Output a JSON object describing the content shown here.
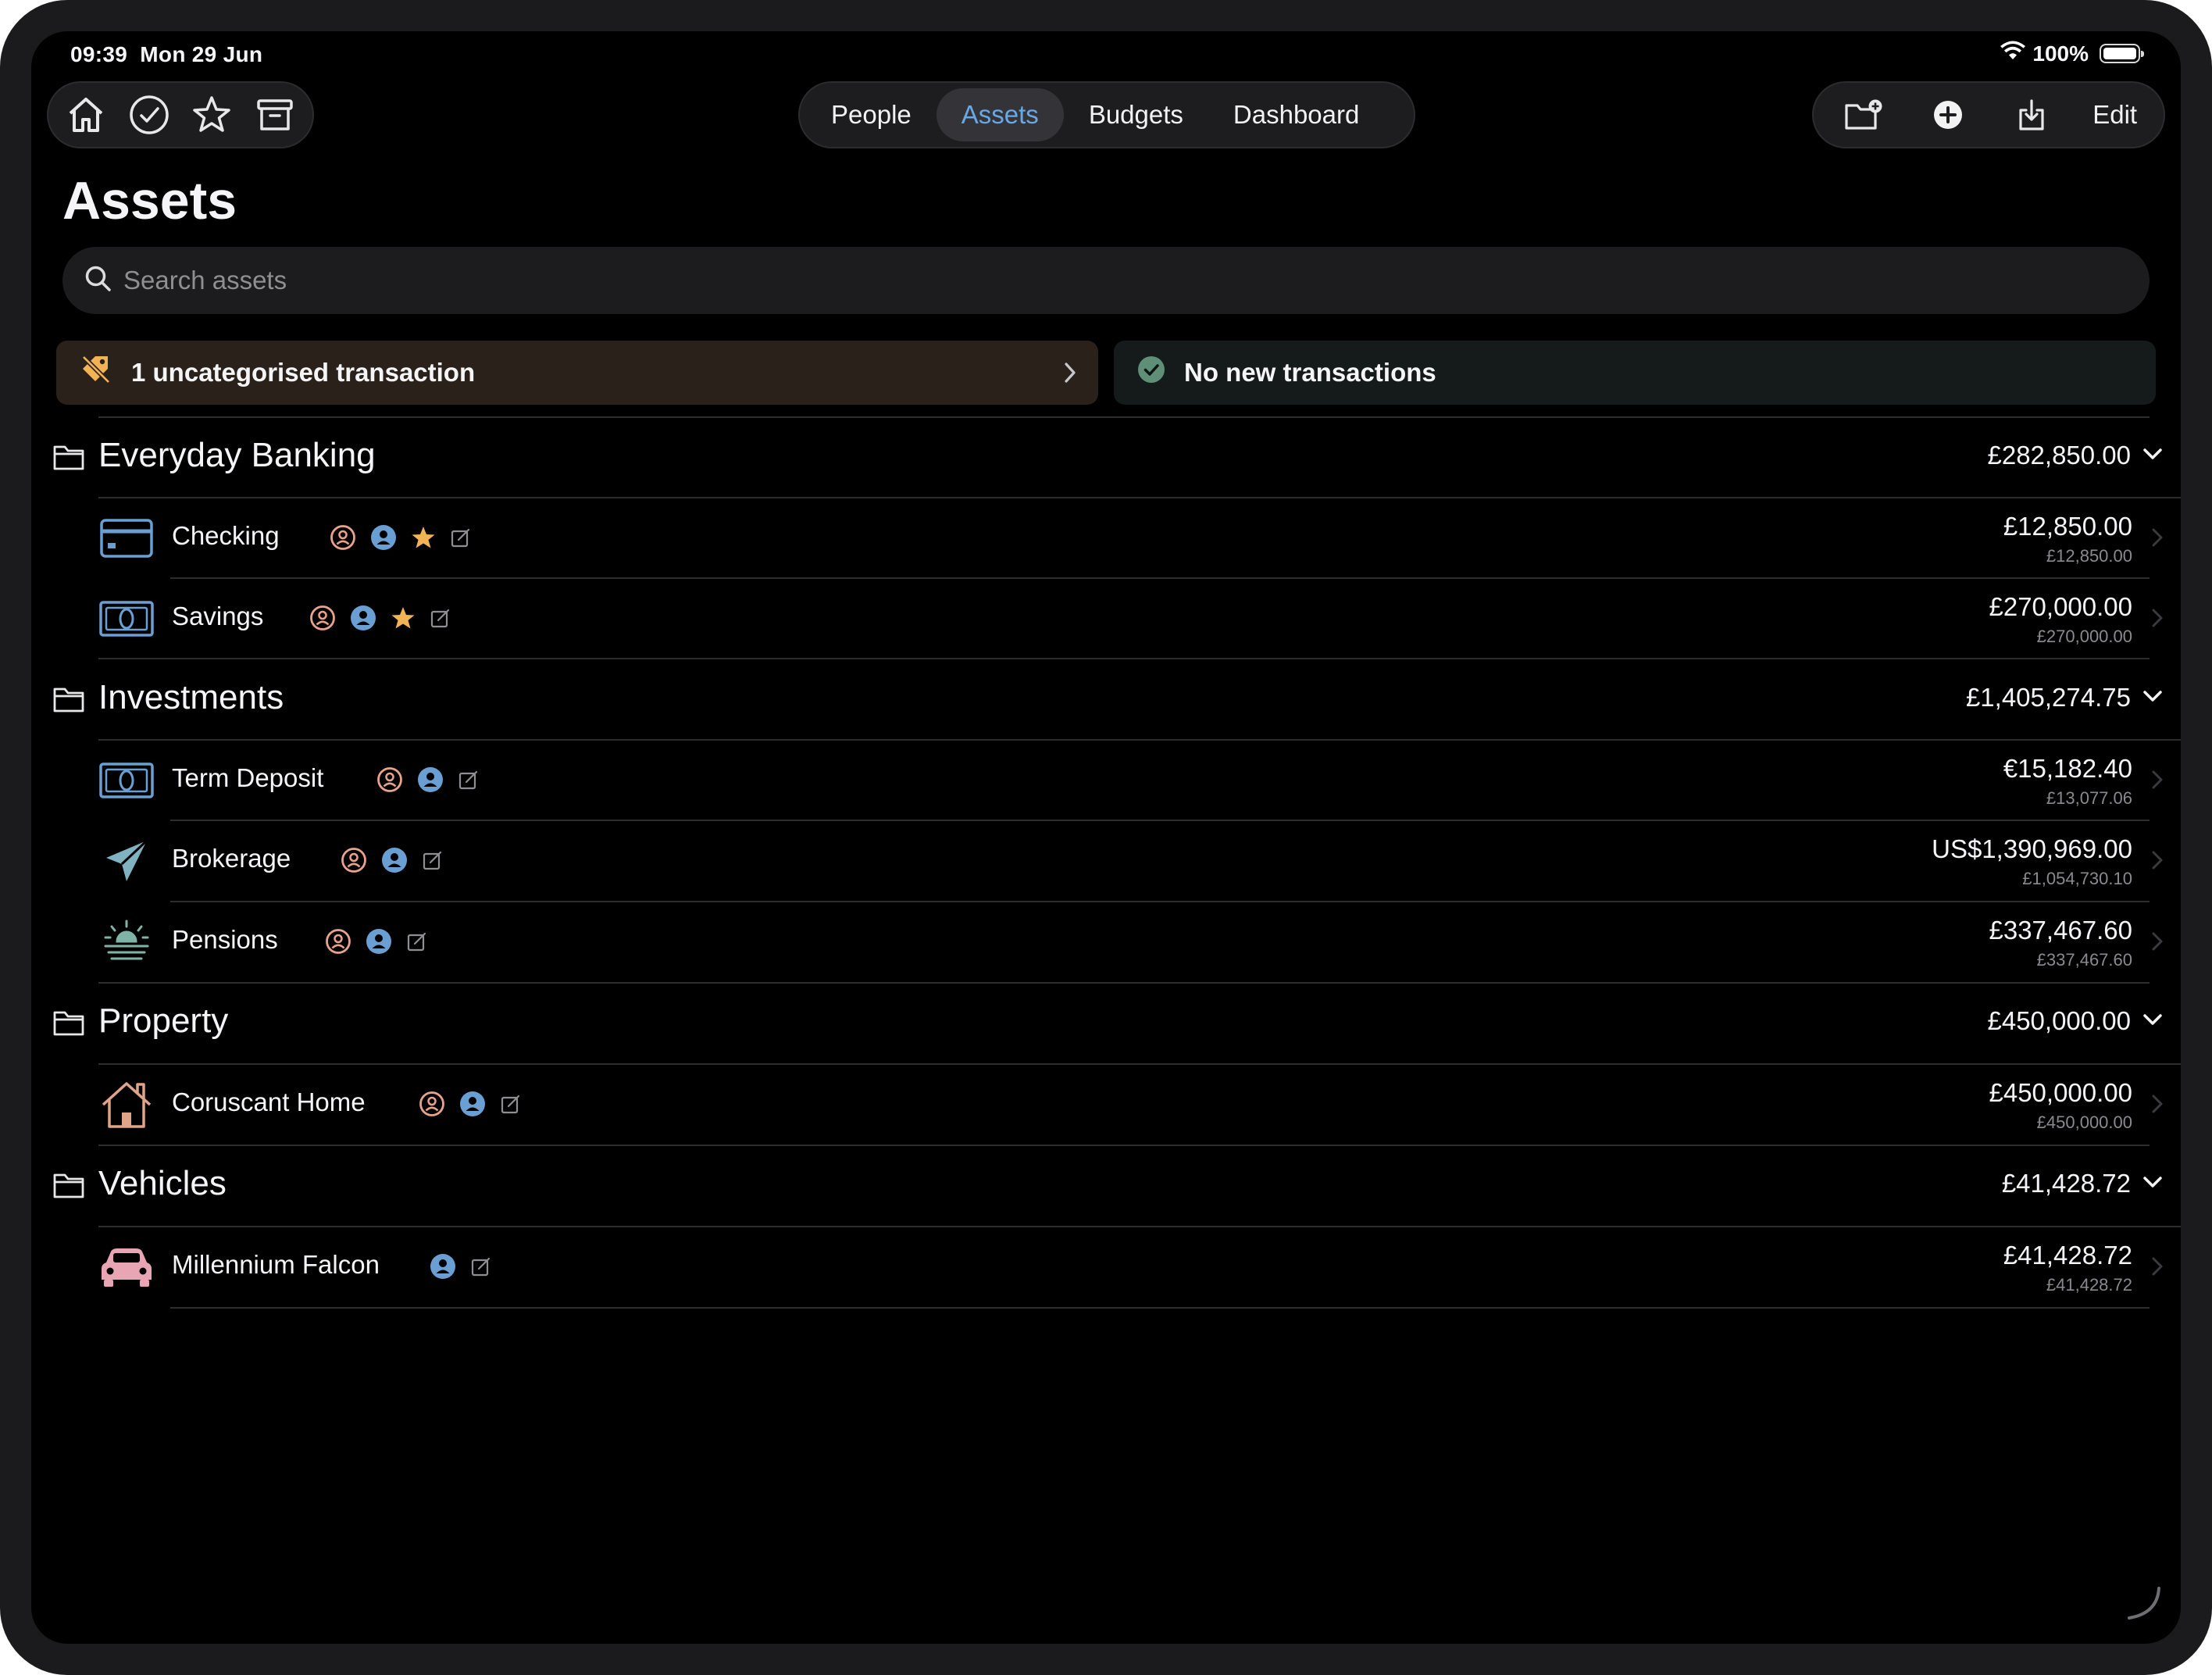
{
  "status": {
    "time": "09:39",
    "date": "Mon 29 Jun",
    "battery": "100%"
  },
  "nav": {
    "tabs": [
      {
        "label": "People",
        "active": false
      },
      {
        "label": "Assets",
        "active": true
      },
      {
        "label": "Budgets",
        "active": false
      },
      {
        "label": "Dashboard",
        "active": false
      }
    ],
    "edit_label": "Edit"
  },
  "page": {
    "title": "Assets"
  },
  "search": {
    "placeholder": "Search assets"
  },
  "banners": {
    "uncategorised": "1 uncategorised transaction",
    "no_new": "No new transactions"
  },
  "groups": {
    "everyday": {
      "name": "Everyday Banking",
      "total": "£282,850.00"
    },
    "investments": {
      "name": "Investments",
      "total": "£1,405,274.75"
    },
    "property": {
      "name": "Property",
      "total": "£450,000.00"
    },
    "vehicles": {
      "name": "Vehicles",
      "total": "£41,428.72"
    }
  },
  "accounts": {
    "checking": {
      "name": "Checking",
      "amount": "£12,850.00",
      "converted": "£12,850.00",
      "starred": true
    },
    "savings": {
      "name": "Savings",
      "amount": "£270,000.00",
      "converted": "£270,000.00",
      "starred": true
    },
    "term_deposit": {
      "name": "Term Deposit",
      "amount": "€15,182.40",
      "converted": "£13,077.06",
      "starred": false
    },
    "brokerage": {
      "name": "Brokerage",
      "amount": "US$1,390,969.00",
      "converted": "£1,054,730.10",
      "starred": false
    },
    "pensions": {
      "name": "Pensions",
      "amount": "£337,467.60",
      "converted": "£337,467.60",
      "starred": false
    },
    "home": {
      "name": "Coruscant Home",
      "amount": "£450,000.00",
      "converted": "£450,000.00",
      "starred": false
    },
    "falcon": {
      "name": "Millennium Falcon",
      "amount": "£41,428.72",
      "converted": "£41,428.72",
      "starred": false
    }
  },
  "colors": {
    "accent_blue": "#69a8e6",
    "owner_peach": "#e8a38c",
    "owner_blue": "#6a9fd4",
    "star_gold": "#f2b354",
    "warn_bg": "#2a221a",
    "ok_green": "#5f8f76"
  },
  "icons": {
    "toolbar_left": [
      "home-icon",
      "checkmark-circle-icon",
      "star-icon",
      "archive-icon"
    ],
    "toolbar_right": [
      "new-folder-icon",
      "add-circle-icon",
      "import-icon"
    ]
  }
}
